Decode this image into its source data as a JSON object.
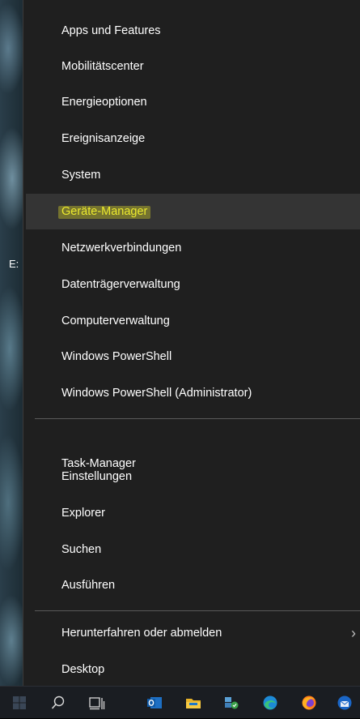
{
  "menu": {
    "items_top": [
      {
        "label": "Apps und Features"
      },
      {
        "label": "Mobilitätscenter"
      },
      {
        "label": "Energieoptionen"
      },
      {
        "label": "Ereignisanzeige"
      },
      {
        "label": "System"
      },
      {
        "label": "Geräte-Manager",
        "state": "hovered-highlighted"
      },
      {
        "label": "Netzwerkverbindungen"
      },
      {
        "label": "Datenträgerverwaltung"
      },
      {
        "label": "Computerverwaltung"
      },
      {
        "label": "Windows PowerShell"
      },
      {
        "label": "Windows PowerShell (Administrator)"
      }
    ],
    "items_middle": [
      {
        "label": "Task-Manager"
      },
      {
        "label": "Einstellungen"
      },
      {
        "label": "Explorer"
      },
      {
        "label": "Suchen"
      },
      {
        "label": "Ausführen"
      }
    ],
    "items_bottom": [
      {
        "label": "Herunterfahren oder abmelden",
        "submenu_glyph": "›"
      },
      {
        "label": "Desktop"
      }
    ]
  },
  "desktop": {
    "edge_text": "E:"
  },
  "taskbar": {
    "icons": [
      "windows-start-icon",
      "search-icon",
      "task-view-icon",
      "outlook-icon",
      "file-explorer-icon",
      "network-app-icon",
      "edge-icon",
      "firefox-icon",
      "thunderbird-icon"
    ]
  },
  "colors": {
    "menu_background": "#1f1f1f",
    "hover_background": "#343434",
    "highlight": "#f0ec28",
    "text": "#ffffff",
    "taskbar": "#1a1d22"
  }
}
